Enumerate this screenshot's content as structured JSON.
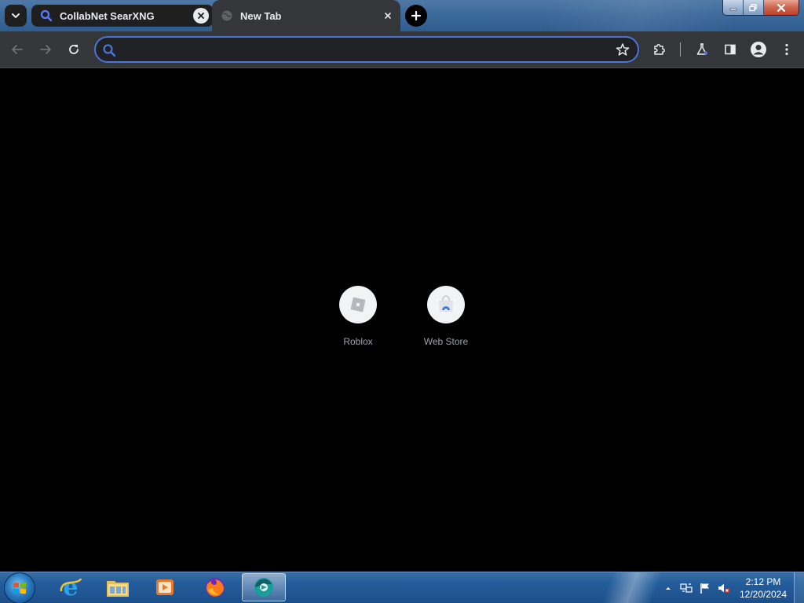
{
  "browser": {
    "tabs": [
      {
        "title": "CollabNet SearXNG",
        "icon": "search-icon",
        "active": false
      },
      {
        "title": "New Tab",
        "icon": "globe-icon",
        "active": true
      }
    ],
    "omnibox": {
      "value": "",
      "placeholder": ""
    },
    "accent_color": "#4c74d8",
    "theme": "dark"
  },
  "new_tab_page": {
    "shortcuts": [
      {
        "label": "Roblox",
        "icon": "roblox-icon"
      },
      {
        "label": "Web Store",
        "icon": "web-store-icon"
      }
    ]
  },
  "taskbar": {
    "pinned_apps": [
      "internet-explorer-icon",
      "file-explorer-icon",
      "media-player-icon",
      "firefox-icon",
      "chrome-app-icon"
    ],
    "clock": {
      "time": "2:12 PM",
      "date": "12/20/2024"
    }
  }
}
